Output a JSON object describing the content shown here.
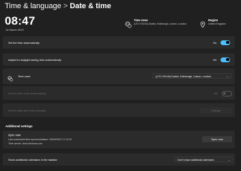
{
  "header": {
    "breadcrumb_parent": "Time & language",
    "separator": ">",
    "page_title": "Date & time"
  },
  "clock": {
    "time": "08:47",
    "date": "16 March 2023"
  },
  "timezone_info": {
    "label": "Time zone",
    "value": "(UTC+00:00) Dublin, Edinburgh, Lisbon, London"
  },
  "region_info": {
    "label": "Region",
    "value": "United Kingdom"
  },
  "settings": {
    "auto_time": {
      "label": "Set the time automatically",
      "state": "On"
    },
    "dst": {
      "label": "Adjust for daylight saving time automatically",
      "state": "On"
    },
    "time_zone": {
      "label": "Time zone",
      "value": "(UTC+00:00) Dublin, Edinburgh, Lisbon, London"
    },
    "auto_timezone": {
      "label": "Set the time zone automatically",
      "state": "Off"
    },
    "manual": {
      "label": "Set the date and time manually",
      "button": "Change"
    }
  },
  "additional": {
    "heading": "Additional settings",
    "sync": {
      "title": "Sync now",
      "last_sync": "Last successful time synchronisation: 16/03/2023 17:13:22",
      "server": "Time server: time.windows.com",
      "button": "Sync now"
    },
    "calendars": {
      "label": "Show additional calendars in the taskbar",
      "value": "Don't show additional calendars"
    }
  },
  "colors": {
    "background": "#202020",
    "card": "#2b2b2b",
    "accent": "#4cc2ff"
  },
  "icons": [
    "globe-clock-icon",
    "location-pin-icon",
    "chevron-down-icon"
  ]
}
